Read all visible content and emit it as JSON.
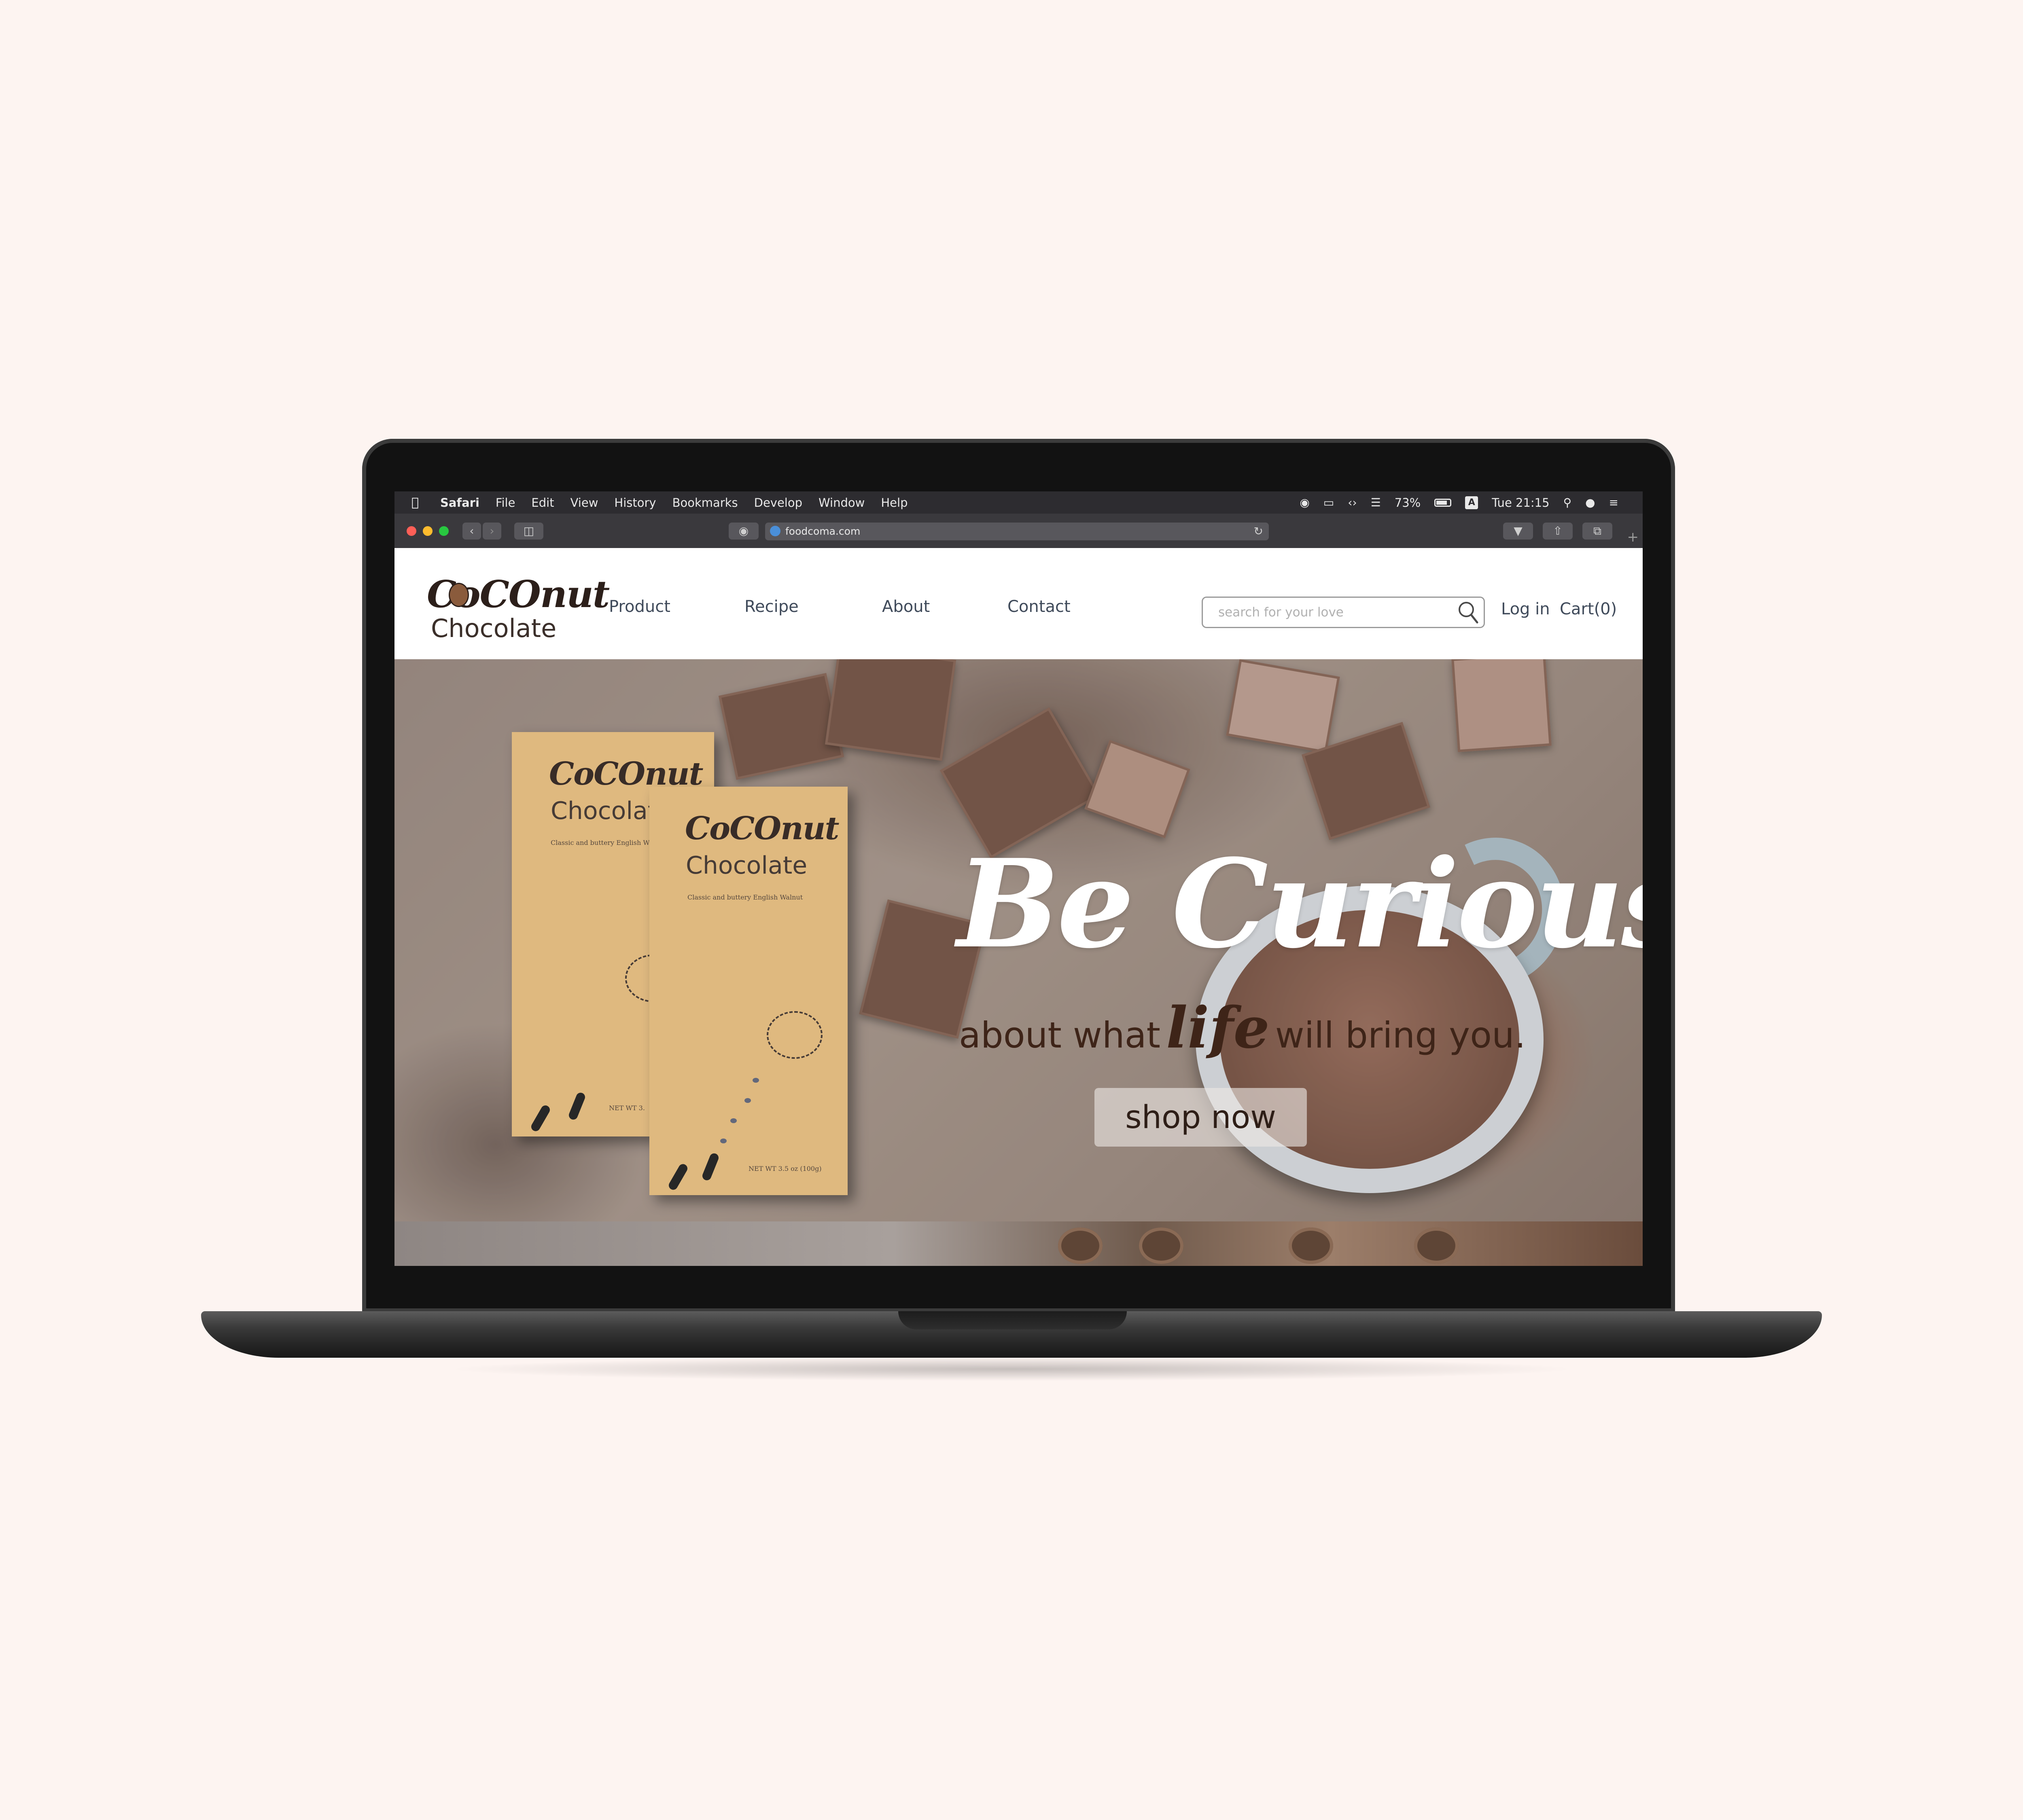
{
  "menubar": {
    "app": "Safari",
    "items": [
      "File",
      "Edit",
      "View",
      "History",
      "Bookmarks",
      "Develop",
      "Window",
      "Help"
    ],
    "battery": "73%",
    "clock": "Tue 21:15",
    "input_source": "A"
  },
  "browser": {
    "url": "foodcoma.com"
  },
  "site": {
    "logo_script": "CoCOnut",
    "logo_word": "Chocolate",
    "nav": [
      "Product",
      "Recipe",
      "About",
      "Contact"
    ],
    "search_placeholder": "search for your love",
    "login": "Log in",
    "cart": "Cart(0)",
    "hero": {
      "headline": "Be Curious",
      "sub_before": "about what",
      "sub_emphasis": "life",
      "sub_after": "will bring you.",
      "cta": "shop now"
    },
    "package": {
      "script": "CoCOnut",
      "word": "Chocolate",
      "description": "Classic and buttery English Walnut",
      "net_weight": "NET WT 3.5 oz (100g)",
      "net_weight_partial": "NET WT 3."
    }
  },
  "colors": {
    "page_background": "#fdf4f1",
    "nav_text": "#3f4a5a",
    "package": "#ddb578",
    "headline": "#ffffff",
    "subline": "#3e2418"
  }
}
